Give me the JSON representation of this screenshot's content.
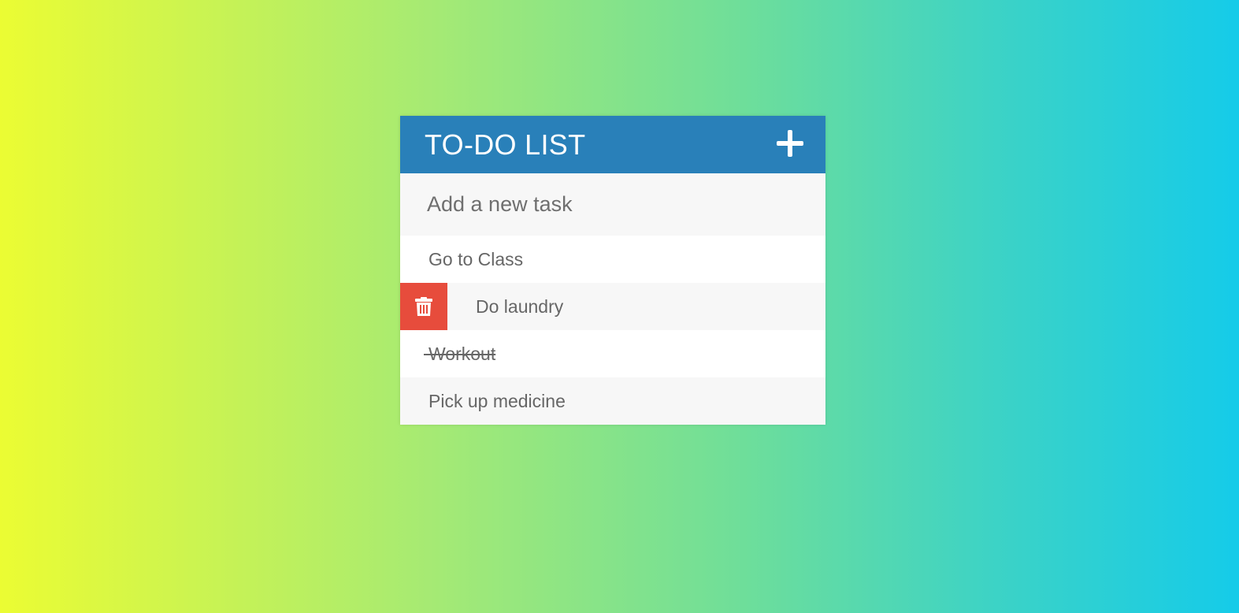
{
  "header": {
    "title": "TO-DO LIST",
    "add_icon": "plus-icon"
  },
  "new_task": {
    "placeholder": "Add a new task",
    "value": ""
  },
  "tasks": [
    {
      "label": "Go to Class",
      "completed": false,
      "delete_visible": false
    },
    {
      "label": "Do laundry",
      "completed": false,
      "delete_visible": true
    },
    {
      "label": "Workout",
      "completed": true,
      "delete_visible": false
    },
    {
      "label": "Pick up medicine",
      "completed": false,
      "delete_visible": false
    }
  ],
  "icons": {
    "delete": "trash-icon"
  },
  "colors": {
    "header": "#2980b9",
    "delete": "#e74c3c",
    "text": "#666666",
    "row_alt": "#f7f7f7",
    "row": "#ffffff"
  }
}
